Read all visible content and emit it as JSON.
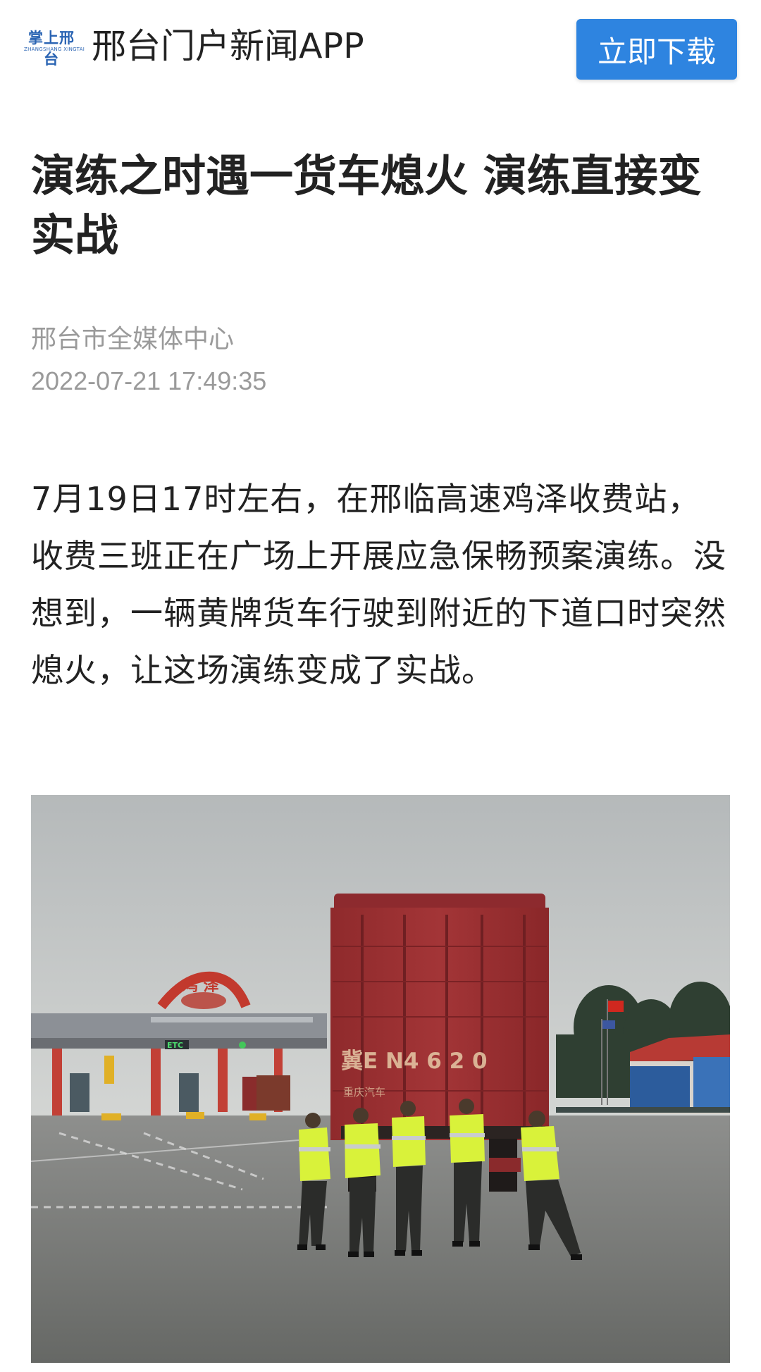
{
  "header": {
    "logo_text": "掌上邢台",
    "logo_subtext": "ZHANGSHANG XINGTAI",
    "app_name": "邢台门户新闻APP",
    "download_label": "立即下载"
  },
  "article": {
    "title": "演练之时遇一货车熄火 演练直接变实战",
    "source": "邢台市全媒体中心",
    "datetime": "2022-07-21 17:49:35",
    "paragraph": "7月19日17时左右，在邢临高速鸡泽收费站，收费三班正在广场上开展应急保畅预案演练。没想到，一辆黄牌货车行驶到附近的下道口时突然熄火，让这场演练变成了实战。"
  },
  "photo": {
    "toll_sign": "鸡 泽",
    "etc_label": "ETC",
    "plate_text": "冀E N4 6 2 0",
    "truck_brand": "重庆汽车"
  },
  "colors": {
    "accent": "#2e84e0",
    "logo_blue": "#2a64b3",
    "meta_gray": "#9a9a9a"
  }
}
